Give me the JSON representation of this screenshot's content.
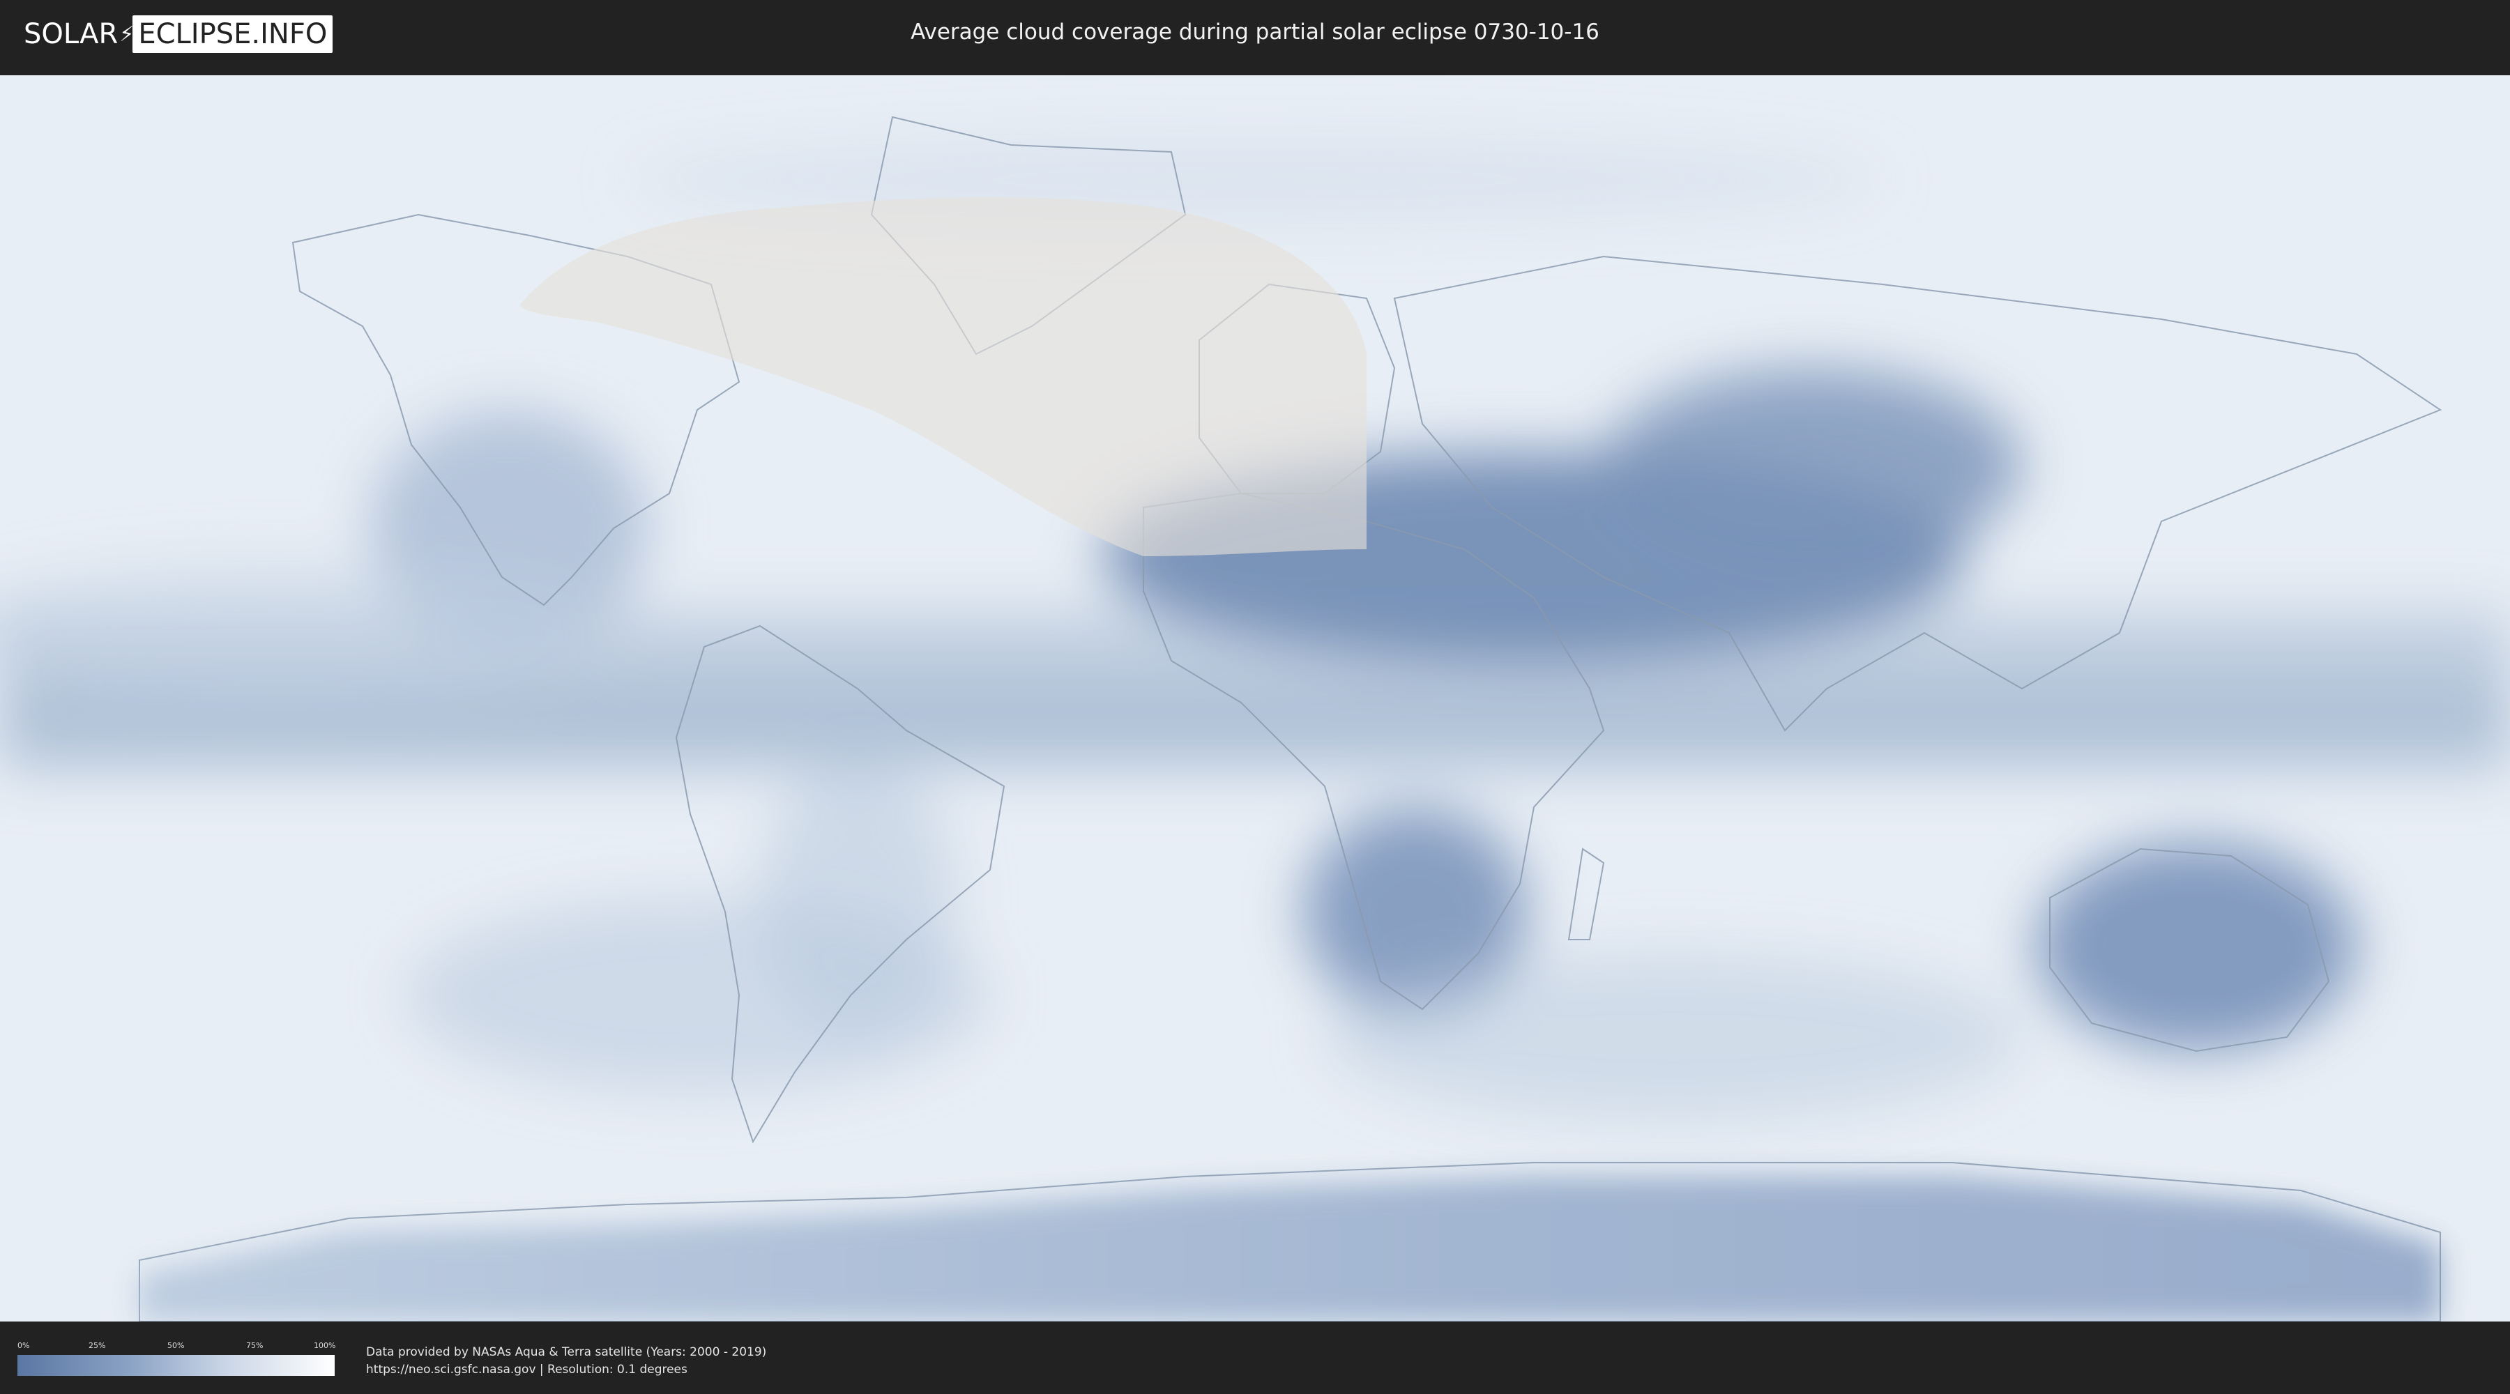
{
  "header": {
    "logo_left": "SOLAR",
    "logo_right": "ECLIPSE.INFO",
    "title": "Average cloud coverage during partial solar eclipse 0730-10-16"
  },
  "legend": {
    "ticks": [
      "0%",
      "25%",
      "50%",
      "75%",
      "100%"
    ],
    "low_color": "#5a76a3",
    "high_color": "#ffffff"
  },
  "footer": {
    "credit_line1": "Data provided by NASAs Aqua & Terra satellite (Years: 2000 - 2019)",
    "credit_line2": "https://neo.sci.gsfc.nasa.gov | Resolution: 0.1 degrees"
  },
  "colors": {
    "background": "#222222",
    "cloud_clear": "#5a76a3",
    "cloud_full": "#ffffff",
    "eclipse_zone": "#e5e1da"
  }
}
